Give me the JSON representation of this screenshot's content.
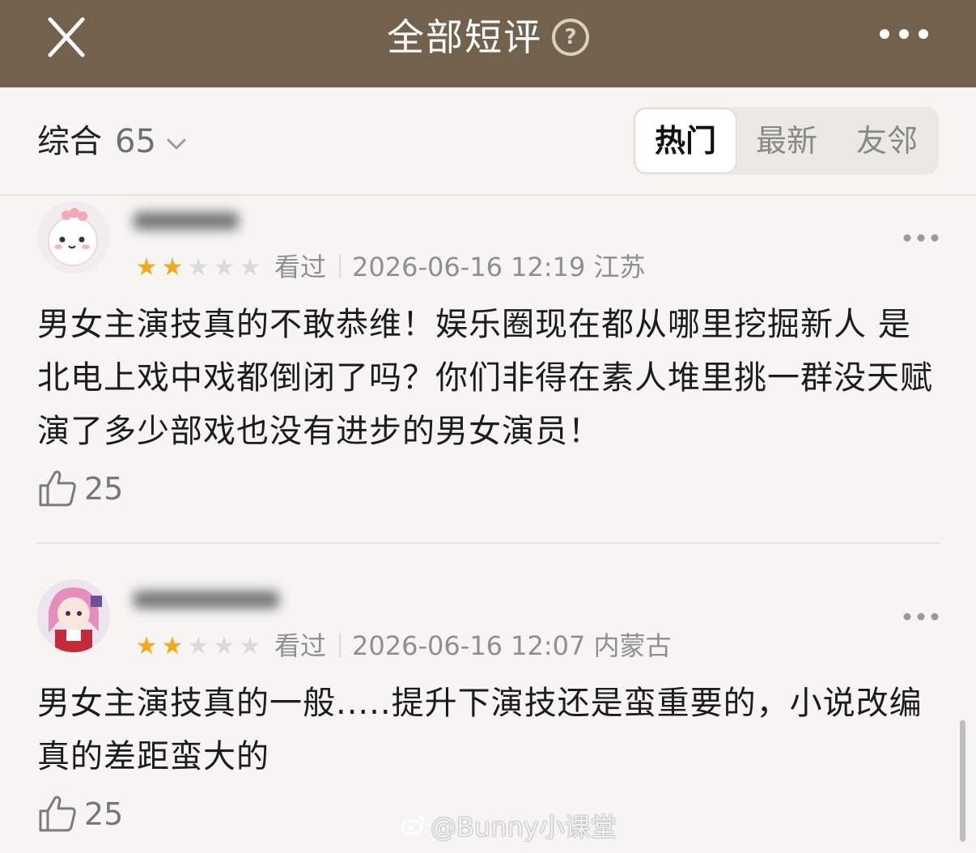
{
  "header": {
    "title": "全部短评",
    "help_symbol": "?",
    "close_icon": "close-icon",
    "more_icon": "more-horizontal-icon"
  },
  "filter": {
    "sort_label": "综合",
    "count": "65",
    "tabs": [
      "热门",
      "最新",
      "友邻"
    ],
    "active_tab": "热门"
  },
  "reviews": [
    {
      "rating": 2,
      "rating_max": 5,
      "status": "看过",
      "datetime": "2026-06-16 12:19",
      "location": "江苏",
      "text": "男女主演技真的不敢恭维！娱乐圈现在都从哪里挖掘新人 是北电上戏中戏都倒闭了吗？你们非得在素人堆里挑一群没天赋演了多少部戏也没有进步的男女演员！",
      "likes": "25"
    },
    {
      "rating": 2,
      "rating_max": 5,
      "status": "看过",
      "datetime": "2026-06-16 12:07",
      "location": "内蒙古",
      "text": "男女主演技真的一般.....提升下演技还是蛮重要的，小说改编真的差距蛮大的",
      "likes": "25"
    }
  ],
  "watermark": "@Bunny小课堂",
  "colors": {
    "header_bg": "#72624d",
    "page_bg": "#f6f5f1",
    "star_on": "#f2a91c",
    "star_off": "#dadada"
  }
}
